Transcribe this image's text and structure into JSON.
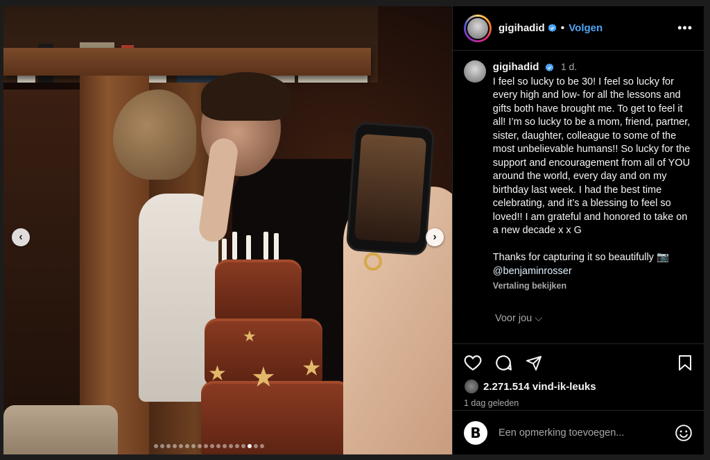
{
  "post": {
    "username": "gigihadid",
    "follow_label": "Volgen",
    "separator": "•",
    "more_label": "•••",
    "caption_time": "1 d.",
    "caption_text": "I feel so lucky to be 30! I feel so lucky for every high and low- for all the lessons and gifts both have brought me. To get to feel it all! I’m so lucky to be a mom, friend, partner, sister, daughter, colleague to some of the most unbelievable humans!! So lucky for the support and encouragement from all of YOU around the world, every day and on my birthday last week. I had the best time celebrating, and it’s a blessing to feel so loved!! I am grateful and honored to take on a new decade x x G\n\nThanks for capturing it so beautifully 📷",
    "mention": "@benjaminrosser",
    "translate_label": "Vertaling bekijken",
    "for_you_label": "Voor jou ⌵",
    "likes_label": "2.271.514 vind-ik-leuks",
    "posted_ago": "1 dag geleden",
    "comment_placeholder": "Een opmerking toevoegen...",
    "brand_letter": "B"
  },
  "media": {
    "prev_label": "‹",
    "next_label": "›",
    "dot_count": 18,
    "active_dot": 15
  },
  "icons": {
    "like": "heart-icon",
    "comment": "comment-icon",
    "share": "send-icon",
    "save": "bookmark-icon",
    "emoji": "emoji-icon",
    "verified": "verified-badge-icon"
  },
  "colors": {
    "accent": "#4ea5f6",
    "background": "#000000",
    "muted_text": "#a8a8a8"
  }
}
